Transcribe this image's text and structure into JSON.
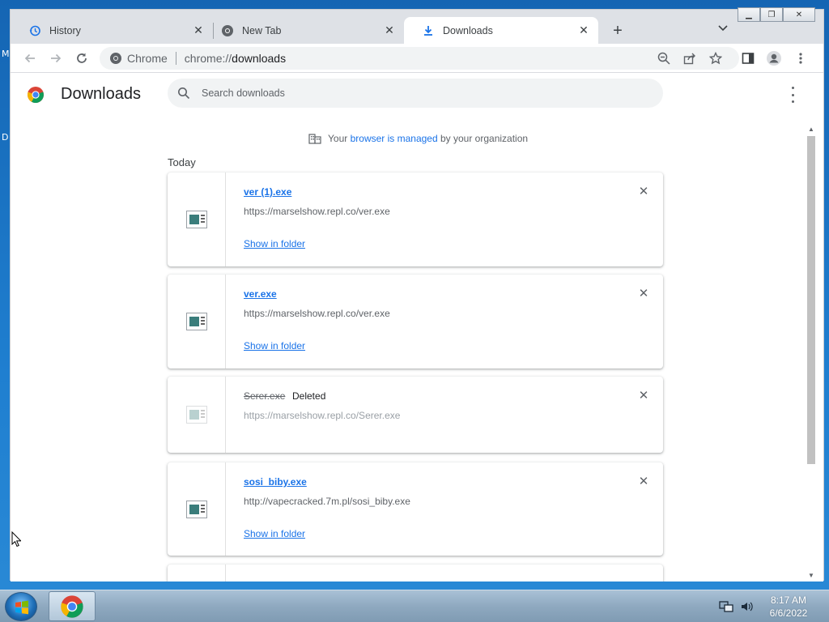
{
  "desktop": {
    "letters": [
      "M",
      "D"
    ]
  },
  "tabs": [
    {
      "label": "History",
      "icon": "history-icon"
    },
    {
      "label": "New Tab",
      "icon": "chrome-icon"
    },
    {
      "label": "Downloads",
      "icon": "download-icon",
      "active": true
    }
  ],
  "toolbar": {
    "site_label": "Chrome",
    "url_scheme": "chrome://",
    "url_path": "downloads"
  },
  "page": {
    "title": "Downloads",
    "search_placeholder": "Search downloads",
    "managed_prefix": "Your ",
    "managed_link": "browser is managed",
    "managed_suffix": " by your organization",
    "section_title": "Today"
  },
  "downloads": [
    {
      "name": "ver (1).exe",
      "url": "https://marselshow.repl.co/ver.exe",
      "action": "Show in folder",
      "status": ""
    },
    {
      "name": "ver.exe",
      "url": "https://marselshow.repl.co/ver.exe",
      "action": "Show in folder",
      "status": ""
    },
    {
      "name": "Serer.exe",
      "url": "https://marselshow.repl.co/Serer.exe",
      "action": "",
      "status": "Deleted"
    },
    {
      "name": "sosi_biby.exe",
      "url": "http://vapecracked.7m.pl/sosi_biby.exe",
      "action": "Show in folder",
      "status": ""
    }
  ],
  "taskbar": {
    "time": "8:17 AM",
    "date": "6/6/2022"
  },
  "colors": {
    "link": "#1a73e8",
    "tabstrip": "#dee1e6",
    "desktop": "#1d6fb8"
  }
}
